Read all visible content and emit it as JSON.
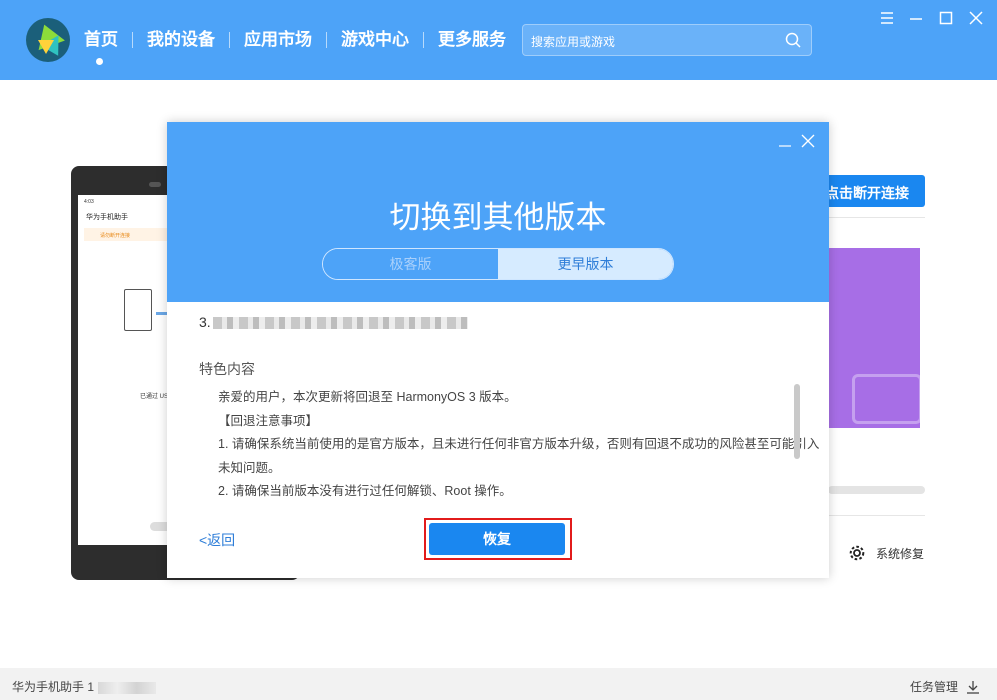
{
  "nav": {
    "items": [
      "首页",
      "我的设备",
      "应用市场",
      "游戏中心",
      "更多服务"
    ]
  },
  "search": {
    "placeholder": "搜索应用或游戏"
  },
  "phone": {
    "status_time": "4:03",
    "app_title": "华为手机助手",
    "warning": "请勿断开连接",
    "usb_hint": "已通过 USB"
  },
  "right": {
    "connect_button": "点击断开连接",
    "repair_label": "系统修复"
  },
  "dialog": {
    "title": "切换到其他版本",
    "tabs": [
      "极客版",
      "更早版本"
    ],
    "line_number": "3.",
    "feature_title": "特色内容",
    "feature_lines": [
      "亲爱的用户，本次更新将回退至 HarmonyOS 3 版本。",
      "【回退注意事项】",
      "1. 请确保系统当前使用的是官方版本，且未进行任何非官方版本升级，否则有回退不成功的风险甚至可能引入",
      "未知问题。",
      "2. 请确保当前版本没有进行过任何解锁、Root 操作。"
    ],
    "back_label": "<返回",
    "restore_button": "恢复"
  },
  "status": {
    "app_name": "华为手机助手",
    "version_prefix": "1",
    "tasks_label": "任务管理"
  },
  "colors": {
    "primary": "#4da3f8",
    "button": "#1a87f0",
    "highlight": "#e21b1b"
  }
}
